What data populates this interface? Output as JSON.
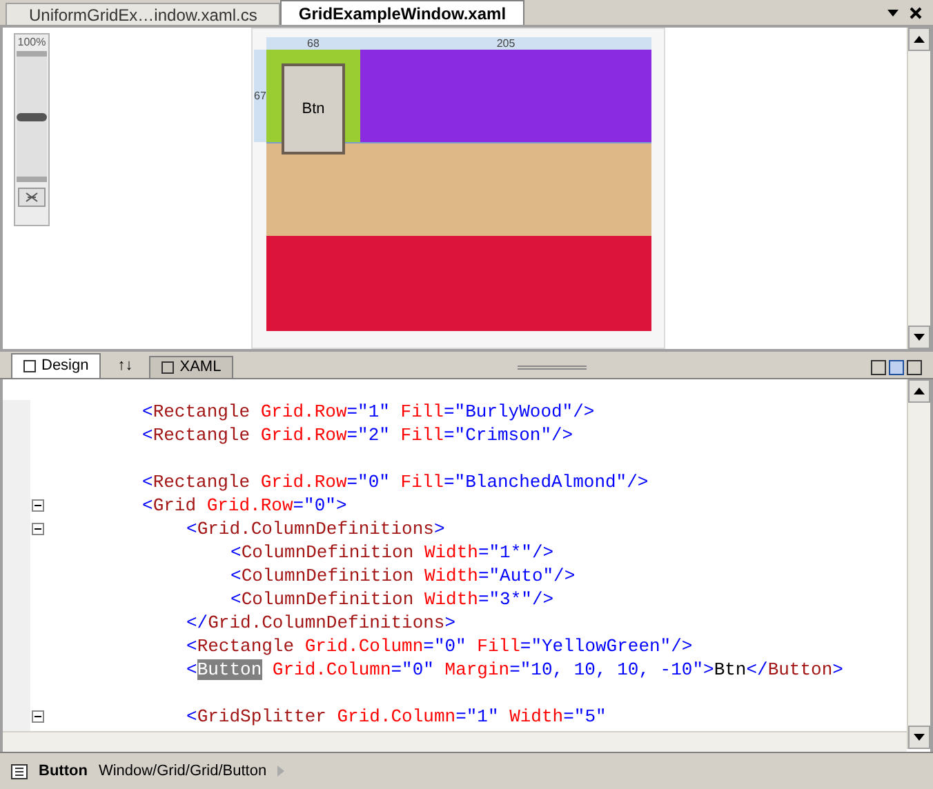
{
  "document_tabs": [
    {
      "label": "UniformGridEx…indow.xaml.cs",
      "selected": false
    },
    {
      "label": "GridExampleWindow.xaml",
      "selected": true
    }
  ],
  "zoom": {
    "label": "100%",
    "level": 0.5
  },
  "designer": {
    "rulers": [
      {
        "kind": "top",
        "text": "68"
      },
      {
        "kind": "top",
        "text": "205"
      },
      {
        "kind": "left",
        "text": "67"
      }
    ],
    "button_label": "Btn"
  },
  "view_tabs": [
    {
      "kind": "tab",
      "label": "Design",
      "selected": true
    },
    {
      "kind": "swap",
      "label": "↑↓",
      "selected": false
    },
    {
      "kind": "tab",
      "label": "XAML",
      "selected": false
    }
  ],
  "code": [
    {
      "kind": "outer",
      "fold": false,
      "tokens": [
        {
          "kind": "punct",
          "text": "<"
        },
        {
          "kind": "element",
          "text": "Rectangle"
        },
        {
          "kind": "attr",
          "text": " Grid.Row"
        },
        {
          "kind": "punct",
          "text": "=\"1\""
        },
        {
          "kind": "attr",
          "text": " Fill"
        },
        {
          "kind": "punct",
          "text": "=\"BurlyWood\"/>"
        }
      ]
    },
    {
      "kind": "outer",
      "fold": false,
      "tokens": [
        {
          "kind": "punct",
          "text": "<"
        },
        {
          "kind": "element",
          "text": "Rectangle"
        },
        {
          "kind": "attr",
          "text": " Grid.Row"
        },
        {
          "kind": "punct",
          "text": "=\"2\""
        },
        {
          "kind": "attr",
          "text": " Fill"
        },
        {
          "kind": "punct",
          "text": "=\"Crimson\"/>"
        }
      ]
    },
    {
      "kind": "blank",
      "fold": false
    },
    {
      "kind": "outer",
      "fold": false,
      "tokens": [
        {
          "kind": "punct",
          "text": "<"
        },
        {
          "kind": "element",
          "text": "Rectangle"
        },
        {
          "kind": "attr",
          "text": " Grid.Row"
        },
        {
          "kind": "punct",
          "text": "=\"0\""
        },
        {
          "kind": "attr",
          "text": " Fill"
        },
        {
          "kind": "punct",
          "text": "=\"BlanchedAlmond\"/>"
        }
      ]
    },
    {
      "kind": "outer",
      "fold": true,
      "tokens": [
        {
          "kind": "punct",
          "text": "<"
        },
        {
          "kind": "element",
          "text": "Grid"
        },
        {
          "kind": "attr",
          "text": " Grid.Row"
        },
        {
          "kind": "punct",
          "text": "=\"0\">"
        }
      ]
    },
    {
      "kind": "inner",
      "fold": true,
      "tokens": [
        {
          "kind": "punct",
          "text": "<"
        },
        {
          "kind": "element",
          "text": "Grid.ColumnDefinitions"
        },
        {
          "kind": "punct",
          "text": ">"
        }
      ]
    },
    {
      "kind": "innermost",
      "fold": false,
      "tokens": [
        {
          "kind": "punct",
          "text": "<"
        },
        {
          "kind": "element",
          "text": "ColumnDefinition"
        },
        {
          "kind": "attr",
          "text": " Width"
        },
        {
          "kind": "punct",
          "text": "=\"1*\"/>"
        }
      ]
    },
    {
      "kind": "innermost",
      "fold": false,
      "tokens": [
        {
          "kind": "punct",
          "text": "<"
        },
        {
          "kind": "element",
          "text": "ColumnDefinition"
        },
        {
          "kind": "attr",
          "text": " Width"
        },
        {
          "kind": "punct",
          "text": "=\"Auto\"/>"
        }
      ]
    },
    {
      "kind": "innermost",
      "fold": false,
      "tokens": [
        {
          "kind": "punct",
          "text": "<"
        },
        {
          "kind": "element",
          "text": "ColumnDefinition"
        },
        {
          "kind": "attr",
          "text": " Width"
        },
        {
          "kind": "punct",
          "text": "=\"3*\"/>"
        }
      ]
    },
    {
      "kind": "inner",
      "fold": false,
      "tokens": [
        {
          "kind": "punct",
          "text": "</"
        },
        {
          "kind": "element",
          "text": "Grid.ColumnDefinitions"
        },
        {
          "kind": "punct",
          "text": ">"
        }
      ]
    },
    {
      "kind": "inner",
      "fold": false,
      "tokens": [
        {
          "kind": "punct",
          "text": "<"
        },
        {
          "kind": "element",
          "text": "Rectangle"
        },
        {
          "kind": "attr",
          "text": " Grid.Column"
        },
        {
          "kind": "punct",
          "text": "=\"0\""
        },
        {
          "kind": "attr",
          "text": " Fill"
        },
        {
          "kind": "punct",
          "text": "=\"YellowGreen\"/>"
        }
      ]
    },
    {
      "kind": "inner",
      "fold": false,
      "tokens": [
        {
          "kind": "punct",
          "text": "<"
        },
        {
          "kind": "highlight",
          "text": "Button"
        },
        {
          "kind": "attr",
          "text": " Grid.Column"
        },
        {
          "kind": "punct",
          "text": "=\"0\""
        },
        {
          "kind": "attr",
          "text": " Margin"
        },
        {
          "kind": "punct",
          "text": "=\"10, 10, 10, -10\">"
        },
        {
          "kind": "text",
          "text": "Btn"
        },
        {
          "kind": "punct",
          "text": "</"
        },
        {
          "kind": "element",
          "text": "Button"
        },
        {
          "kind": "punct",
          "text": ">"
        }
      ]
    },
    {
      "kind": "blank",
      "fold": false
    },
    {
      "kind": "inner",
      "fold": true,
      "tokens": [
        {
          "kind": "punct",
          "text": "<"
        },
        {
          "kind": "element",
          "text": "GridSplitter"
        },
        {
          "kind": "attr",
          "text": " Grid.Column"
        },
        {
          "kind": "punct",
          "text": "=\"1\""
        },
        {
          "kind": "attr",
          "text": " Width"
        },
        {
          "kind": "punct",
          "text": "=\"5\""
        }
      ]
    }
  ],
  "status_bar": {
    "element": "Button",
    "path": "Window/Grid/Grid/Button"
  }
}
